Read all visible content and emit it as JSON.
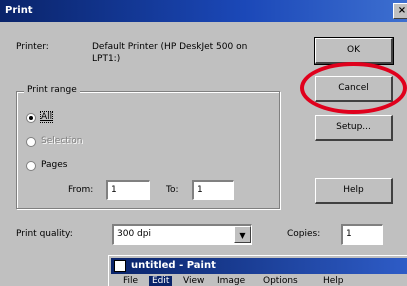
{
  "dialog": {
    "title": "Print",
    "close_glyph": "×",
    "printer_label": "Printer:",
    "printer_value_line1": "Default Printer (HP DeskJet 500 on",
    "printer_value_line2": "LPT1:)"
  },
  "print_range": {
    "legend": "Print range",
    "all": "All",
    "selection": "Selection",
    "pages": "Pages",
    "selected": "All",
    "from_label": "From:",
    "from_value": "1",
    "to_label": "To:",
    "to_value": "1"
  },
  "buttons": {
    "ok": "OK",
    "cancel": "Cancel",
    "setup": "Setup...",
    "help": "Help"
  },
  "quality": {
    "label": "Print quality:",
    "value": "300 dpi",
    "arrow": "▼"
  },
  "copies": {
    "label": "Copies:",
    "value": "1"
  },
  "paint_window": {
    "title": "untitled - Paint",
    "menus": [
      "File",
      "Edit",
      "View",
      "Image",
      "Options",
      "Help"
    ]
  },
  "colors": {
    "highlight_ring": "#e0001c",
    "titlebar": "#0a246a"
  }
}
